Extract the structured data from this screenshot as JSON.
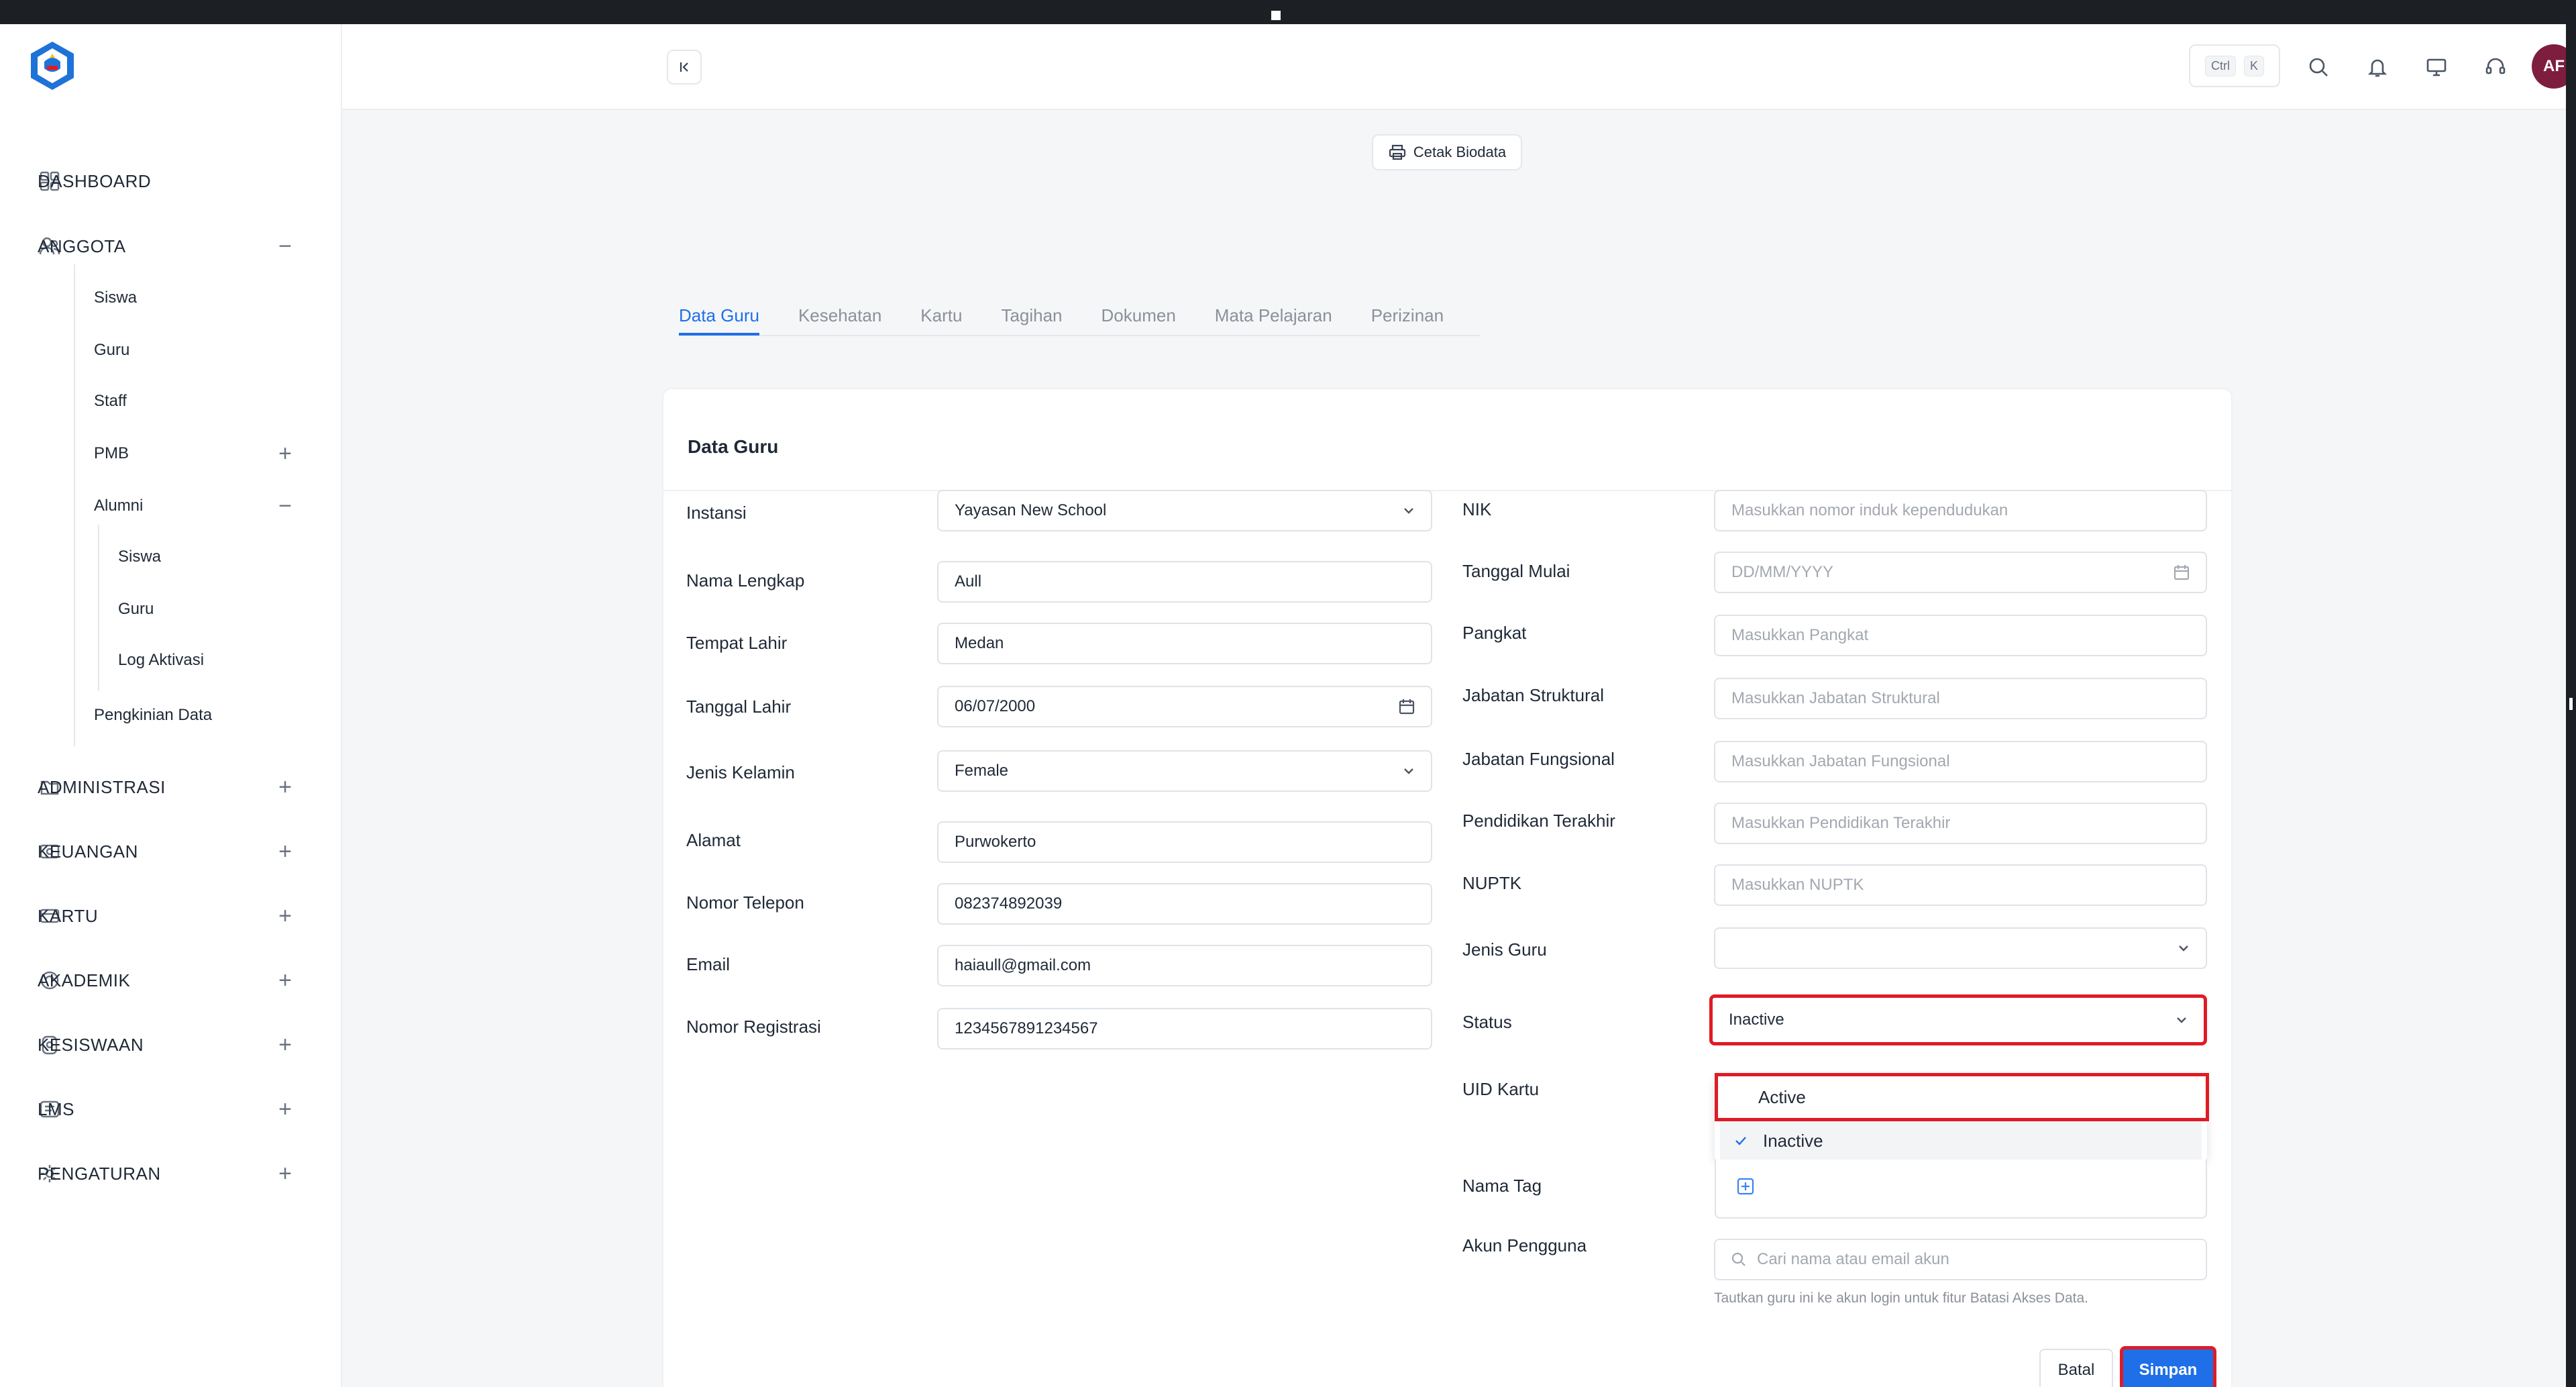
{
  "header": {
    "kbd_ctrl": "Ctrl",
    "kbd_k": "K",
    "avatar_initials": "AF"
  },
  "sidebar": {
    "dashboard": "DASHBOARD",
    "anggota": "ANGGOTA",
    "anggota_items": [
      "Siswa",
      "Guru",
      "Staff",
      "PMB",
      "Alumni"
    ],
    "alumni_items": [
      "Siswa",
      "Guru",
      "Log Aktivasi"
    ],
    "pengkinian": "Pengkinian Data",
    "administrasi": "ADMINISTRASI",
    "keuangan": "KEUANGAN",
    "kartu": "KARTU",
    "akademik": "AKADEMIK",
    "kesiswaan": "KESISWAAN",
    "lms": "LMS",
    "pengaturan": "PENGATURAN"
  },
  "toolbar": {
    "cetak_biodata": "Cetak Biodata"
  },
  "tabs": [
    "Data Guru",
    "Kesehatan",
    "Kartu",
    "Tagihan",
    "Dokumen",
    "Mata Pelajaran",
    "Perizinan"
  ],
  "form": {
    "title": "Data Guru",
    "left": [
      {
        "label": "Instansi",
        "value": "Yayasan New School"
      },
      {
        "label": "Nama Lengkap",
        "value": "Aull"
      },
      {
        "label": "Tempat Lahir",
        "value": "Medan"
      },
      {
        "label": "Tanggal Lahir",
        "value": "06/07/2000"
      },
      {
        "label": "Jenis Kelamin",
        "value": "Female"
      },
      {
        "label": "Alamat",
        "value": "Purwokerto"
      },
      {
        "label": "Nomor Telepon",
        "value": "082374892039"
      },
      {
        "label": "Email",
        "value": "haiaull@gmail.com"
      },
      {
        "label": "Nomor Registrasi",
        "value": "1234567891234567"
      }
    ],
    "right": [
      {
        "label": "NIK",
        "placeholder": "Masukkan nomor induk kependudukan"
      },
      {
        "label": "Tanggal Mulai",
        "placeholder": "DD/MM/YYYY"
      },
      {
        "label": "Pangkat",
        "placeholder": "Masukkan Pangkat"
      },
      {
        "label": "Jabatan Struktural",
        "placeholder": "Masukkan Jabatan Struktural"
      },
      {
        "label": "Jabatan Fungsional",
        "placeholder": "Masukkan Jabatan Fungsional"
      },
      {
        "label": "Pendidikan Terakhir",
        "placeholder": "Masukkan Pendidikan Terakhir"
      },
      {
        "label": "NUPTK",
        "placeholder": "Masukkan NUPTK"
      },
      {
        "label": "Jenis Guru",
        "value": ""
      },
      {
        "label": "Status",
        "value": "Inactive"
      },
      {
        "label": "UID Kartu"
      },
      {
        "label": "Nama Tag"
      },
      {
        "label": "Akun Pengguna",
        "placeholder": "Cari nama atau email akun"
      }
    ],
    "status_options": [
      "Active",
      "Inactive"
    ],
    "akun_hint": "Tautkan guru ini ke akun login untuk fitur Batasi Akses Data.",
    "batal": "Batal",
    "simpan": "Simpan"
  }
}
